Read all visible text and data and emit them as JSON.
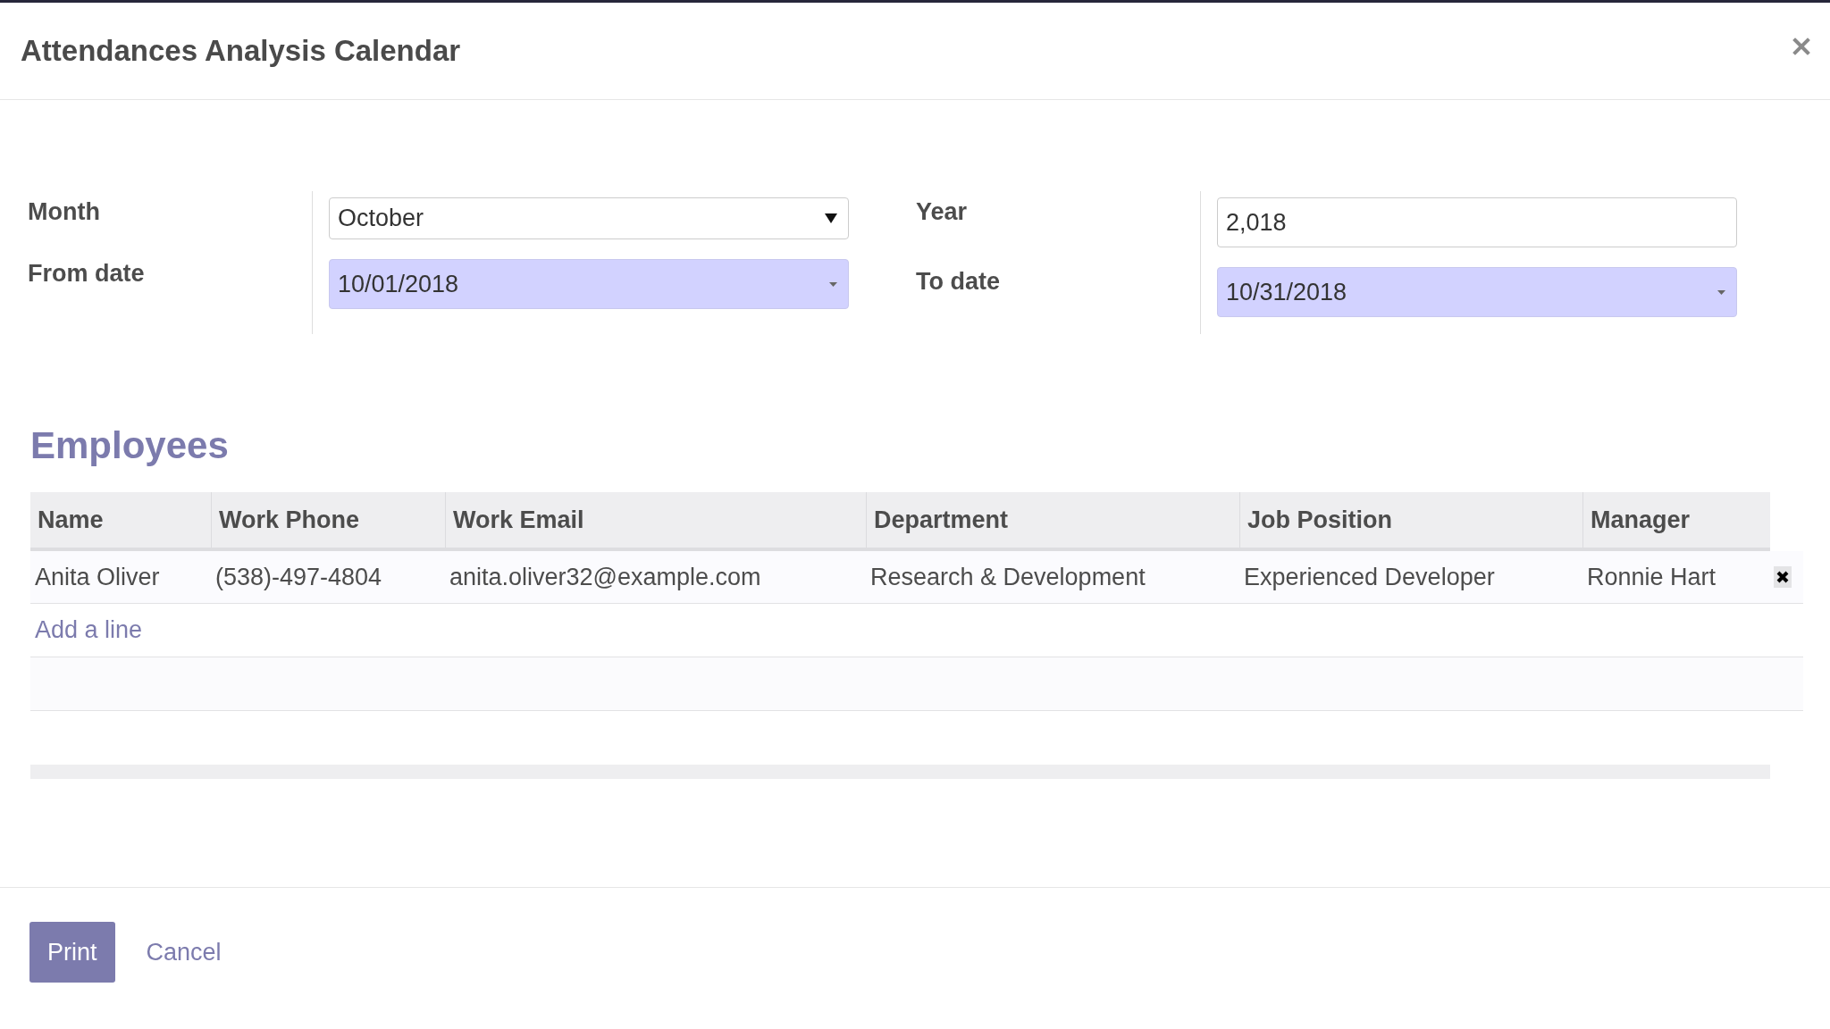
{
  "dialog": {
    "title": "Attendances Analysis Calendar"
  },
  "form": {
    "groups": [
      {
        "fields": [
          {
            "label": "Month",
            "kind": "select",
            "value": "October",
            "required": false
          },
          {
            "label": "From date",
            "kind": "date",
            "value": "10/01/2018",
            "required": true
          }
        ]
      },
      {
        "fields": [
          {
            "label": "Year",
            "kind": "number",
            "value": "2,018",
            "required": false
          },
          {
            "label": "To date",
            "kind": "date",
            "value": "10/31/2018",
            "required": true
          }
        ]
      }
    ]
  },
  "employees": {
    "title": "Employees",
    "columns": [
      "Name",
      "Work Phone",
      "Work Email",
      "Department",
      "Job Position",
      "Manager"
    ],
    "rows": [
      {
        "cells": [
          "Anita Oliver",
          "(538)-497-4804",
          "anita.oliver32@example.com",
          "Research & Development",
          "Experienced Developer",
          "Ronnie Hart"
        ]
      }
    ],
    "add_line": "Add a line"
  },
  "buttons": [
    {
      "label": "Print",
      "kind": "primary"
    },
    {
      "label": "Cancel",
      "kind": "link"
    }
  ]
}
